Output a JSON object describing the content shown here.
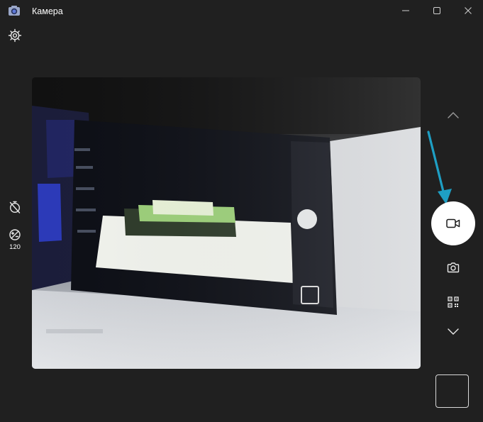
{
  "window": {
    "title": "Камера",
    "app_icon": "camera-app-icon",
    "controls": [
      "minimize-icon",
      "maximize-icon",
      "close-icon"
    ]
  },
  "left_rail": {
    "settings_icon": "gear-icon",
    "timer_icon": "timer-off-icon",
    "exposure": {
      "icon": "exposure-compensation-icon",
      "value": "120"
    }
  },
  "preview": {
    "content": "live-camera-feed"
  },
  "right_rail": {
    "mode_up_icon": "chevron-up-icon",
    "capture_mode": "video",
    "capture_icon": "video-camera-icon",
    "photo_mode_icon": "camera-icon",
    "qr_mode_icon": "qr-code-icon",
    "mode_down_icon": "chevron-down-icon",
    "gallery": "last-capture-thumbnail"
  },
  "colors": {
    "background": "#202020",
    "foreground": "#ffffff",
    "annotation_arrow": "#1e9fc4"
  }
}
